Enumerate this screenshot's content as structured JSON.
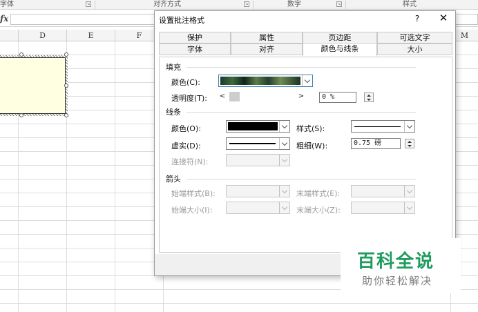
{
  "ribbon": {
    "groups": [
      {
        "label": "字体"
      },
      {
        "label": "对齐方式"
      },
      {
        "label": "数字"
      },
      {
        "label": "样式"
      }
    ]
  },
  "formula_bar": {
    "fx": "fx",
    "value": ""
  },
  "columns": [
    "D",
    "E",
    "F",
    "M"
  ],
  "dialog": {
    "title": "设置批注格式",
    "help": "?",
    "close": "✕",
    "tabs_row1": [
      "保护",
      "属性",
      "页边距",
      "可选文字"
    ],
    "tabs_row2": [
      "字体",
      "对齐",
      "颜色与线条",
      "大小"
    ],
    "active_tab": "颜色与线条",
    "fill": {
      "section": "填充",
      "color_label": "颜色(C):",
      "transparency_label": "透明度(T):",
      "transparency_value": "0 %",
      "slider_left": "<",
      "slider_right": ">"
    },
    "line": {
      "section": "线条",
      "color_label": "颜色(O):",
      "style_label": "样式(S):",
      "dash_label": "虚实(D):",
      "weight_label": "粗细(W):",
      "weight_value": "0.75 磅",
      "connector_label": "连接符(N):",
      "line_color": "#000000"
    },
    "arrows": {
      "section": "箭头",
      "begin_style_label": "始端样式(B):",
      "end_style_label": "末端样式(E):",
      "begin_size_label": "始端大小(I):",
      "end_size_label": "末端大小(Z):"
    }
  },
  "watermark": {
    "title": "百科全说",
    "subtitle": "助你轻松解决"
  },
  "colors": {
    "accent": "#1e9b5e",
    "comment_fill": "#ffffe1"
  }
}
